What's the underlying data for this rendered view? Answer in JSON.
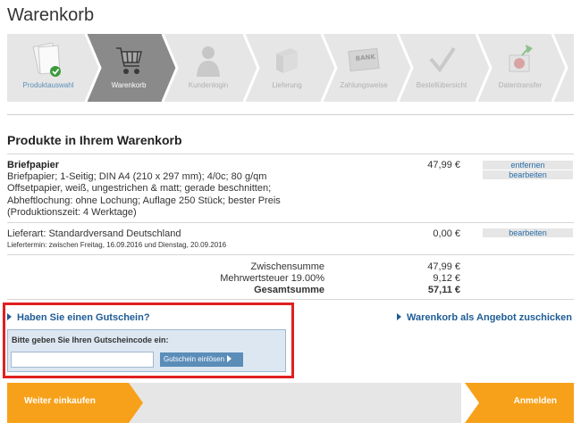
{
  "page": {
    "title": "Warenkorb"
  },
  "steps": [
    {
      "label": "Produktauswahl",
      "icon": "paper-stack-check-icon",
      "state": "done"
    },
    {
      "label": "Warenkorb",
      "icon": "shopping-cart-icon",
      "state": "active"
    },
    {
      "label": "Kundenlogin",
      "icon": "user-icon",
      "state": "todo"
    },
    {
      "label": "Lieferung",
      "icon": "package-icon",
      "state": "todo"
    },
    {
      "label": "Zahlungsweise",
      "icon": "bank-card-icon",
      "state": "todo"
    },
    {
      "label": "Bestellübersicht",
      "icon": "checkmark-icon",
      "state": "todo"
    },
    {
      "label": "Datentransfer",
      "icon": "upload-folder-icon",
      "state": "todo"
    }
  ],
  "cart": {
    "heading": "Produkte in Ihrem Warenkorb",
    "product": {
      "name": "Briefpapier",
      "description": "Briefpapier; 1-Seitig; DIN A4 (210 x 297 mm); 4/0c; 80 g/qm Offsetpapier, weiß, ungestrichen & matt; gerade beschnitten; Abheftlochung: ohne Lochung; Auflage 250 Stück; bester Preis (Produktionszeit: 4 Werktage)",
      "price": "47,99 €",
      "remove_label": "entfernen",
      "edit_label": "bearbeiten"
    },
    "delivery": {
      "label": "Lieferart: Standardversand Deutschland",
      "date": "Liefertermin: zwischen Freitag, 16.09.2016 und Dienstag, 20.09.2016",
      "price": "0,00 €",
      "edit_label": "bearbeiten"
    },
    "totals": {
      "subtotal_label": "Zwischensumme",
      "subtotal": "47,99 €",
      "vat_label": "Mehrwertsteuer 19.00%",
      "vat": "9,12 €",
      "total_label": "Gesamtsumme",
      "total": "57,11 €"
    }
  },
  "coupon": {
    "toggle_label": "Haben Sie einen Gutschein?",
    "prompt": "Bitte geben Sie Ihren Gutscheincode ein:",
    "input_value": "",
    "redeem_label": "Gutschein einlösen"
  },
  "offer_link": "Warenkorb als Angebot zuschicken",
  "nav": {
    "continue_label": "Weiter einkaufen",
    "login_label": "Anmelden"
  },
  "colors": {
    "accent_orange": "#f7a11a",
    "link_blue": "#1d5c95",
    "step_active": "#8a8a8a",
    "highlight_red": "#e02020"
  }
}
